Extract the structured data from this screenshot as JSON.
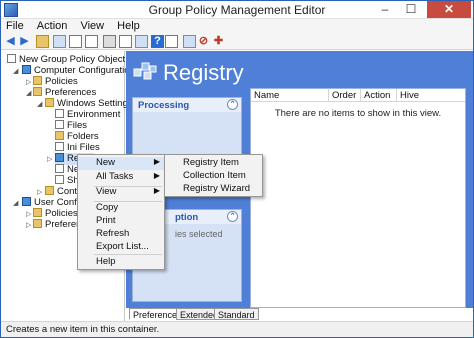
{
  "window": {
    "title": "Group Policy Management Editor"
  },
  "menubar": [
    "File",
    "Action",
    "View",
    "Help"
  ],
  "tree": {
    "root": "New Group Policy Object [WIN-",
    "computer_config": "Computer Configuration",
    "policies": "Policies",
    "preferences": "Preferences",
    "windows_settings": "Windows Settings",
    "environment": "Environment",
    "files": "Files",
    "folders": "Folders",
    "ini_files": "Ini Files",
    "registry_partial": "Regist",
    "network_partial": "Ne",
    "shortcuts_partial": "Sh",
    "control_partial": "Contr",
    "user_config": "User Configura",
    "user_policies": "Policies",
    "user_preferences": "Preferenc"
  },
  "registry": {
    "title": "Registry",
    "processing_header": "Processing",
    "description_header_partial": "ption",
    "description_text_partial": "ies selected"
  },
  "listview": {
    "columns": [
      "Name",
      "Order",
      "Action",
      "Hive"
    ],
    "empty_text": "There are no items to show in this view."
  },
  "tabs": [
    "Preferences",
    "Extended",
    "Standard"
  ],
  "status": "Creates a new item in this container.",
  "context_menu": {
    "items": [
      "New",
      "All Tasks",
      "View",
      "Copy",
      "Print",
      "Refresh",
      "Export List...",
      "Help"
    ]
  },
  "submenu": {
    "items": [
      "Registry Item",
      "Collection Item",
      "Registry Wizard"
    ]
  },
  "colors": {
    "panel_blue": "#4f7fd6",
    "close_red": "#c74b3f",
    "highlight": "#d8e6f7"
  }
}
